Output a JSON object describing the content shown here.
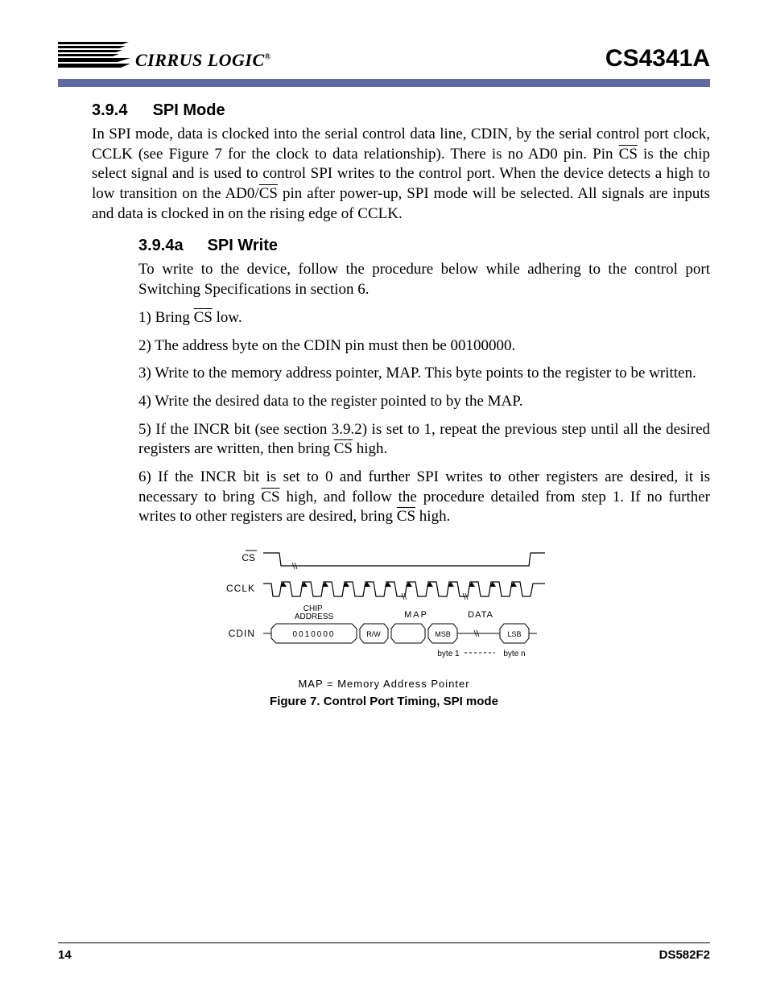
{
  "header": {
    "brand": "CIRRUS LOGIC",
    "part_number": "CS4341A"
  },
  "section": {
    "number": "3.9.4",
    "title": "SPI Mode",
    "intro_html": "In SPI mode, data is clocked into the serial control data line, CDIN, by the serial control port clock, CCLK (see Figure 7 for the clock to data relationship). There is no AD0 pin. Pin <span class=\"overline\">CS</span> is the chip select signal and is used to control SPI writes to the control port. When the device detects a high to low transition on the AD0/<span class=\"overline\">CS</span> pin after power-up, SPI mode will be selected. All signals are inputs and data is clocked in on the rising edge of CCLK."
  },
  "subsection": {
    "number": "3.9.4a",
    "title": "SPI Write",
    "intro": "To write to the device, follow the procedure below while adhering to the control port Switching Specifications in section 6.",
    "steps": [
      "1) Bring <span class=\"overline\">CS</span> low.",
      "2) The address byte on the CDIN pin must then be 00100000.",
      "3) Write to the memory address pointer, MAP. This byte points to the register to be written.",
      "4) Write the desired data to the register pointed to by the MAP.",
      "5) If the INCR bit (see section 3.9.2) is set to 1, repeat the previous step until all the desired registers are written, then bring <span class=\"overline\">CS</span> high.",
      "6) If the INCR bit is set to 0 and further SPI writes to other registers are desired, it is necessary to bring <span class=\"overline\">CS</span> high, and follow the procedure detailed from step 1. If no further writes to other registers are desired, bring <span class=\"overline\">CS</span> high."
    ]
  },
  "figure": {
    "signals": {
      "cs": "CS",
      "cclk": "CCLK",
      "cdin": "CDIN"
    },
    "labels": {
      "chip_address": "CHIP\nADDRESS",
      "chip_address_value": "0010000",
      "rw": "R/W",
      "map": "MAP",
      "msb": "MSB",
      "data": "DATA",
      "lsb": "LSB",
      "byte1": "byte 1",
      "byten": "byte n"
    },
    "note": "MAP = Memory Address Pointer",
    "caption": "Figure 7.  Control Port Timing, SPI mode"
  },
  "footer": {
    "page": "14",
    "doc": "DS582F2"
  }
}
